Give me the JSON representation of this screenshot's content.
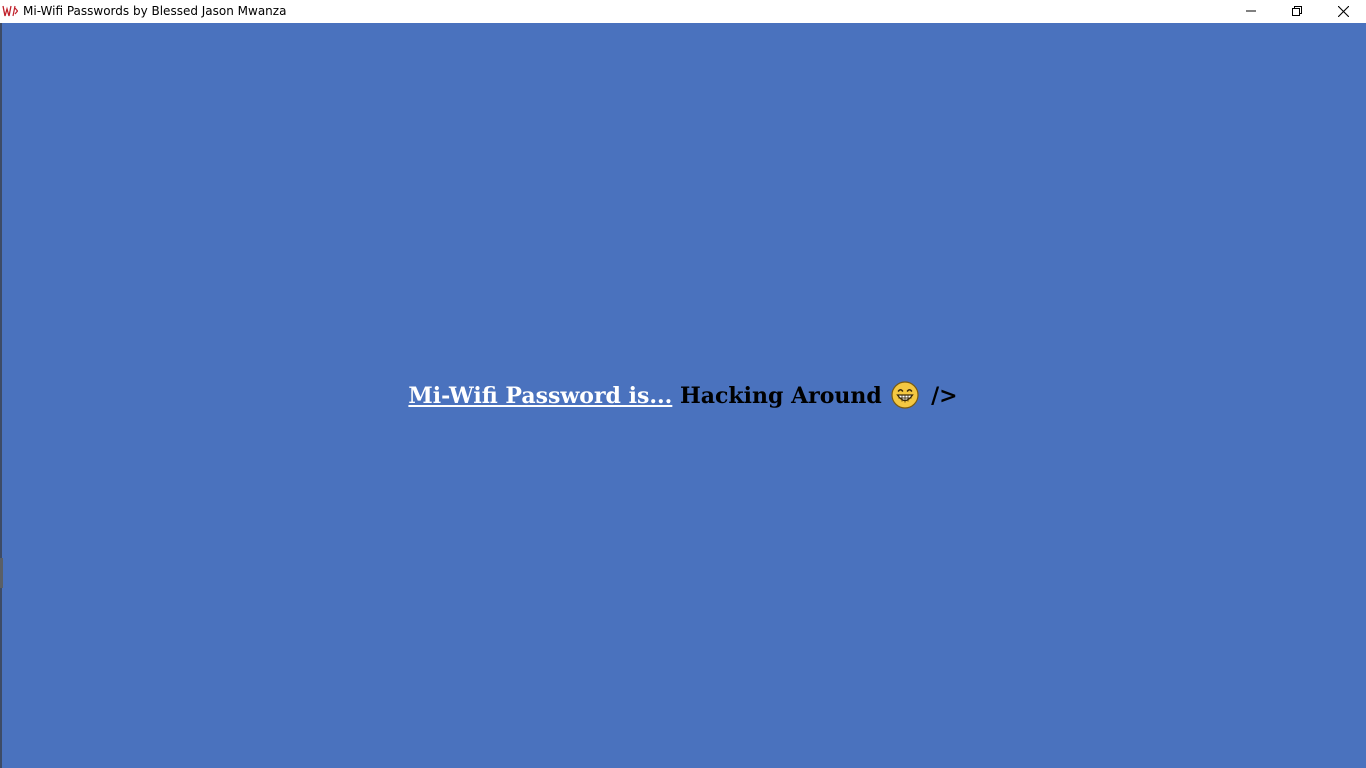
{
  "window": {
    "title": "Mi-Wifi Passwords by Blessed Jason Mwanza",
    "app_icon": "app-logo-icon",
    "controls": [
      "minimize-icon",
      "restore-icon",
      "close-icon"
    ]
  },
  "content": {
    "background_color": "#4a72be",
    "headline_link": "Mi-Wifi Password is...",
    "headline_text": "Hacking Around",
    "emoji": "grinning-face-icon",
    "headline_suffix": "/>"
  }
}
